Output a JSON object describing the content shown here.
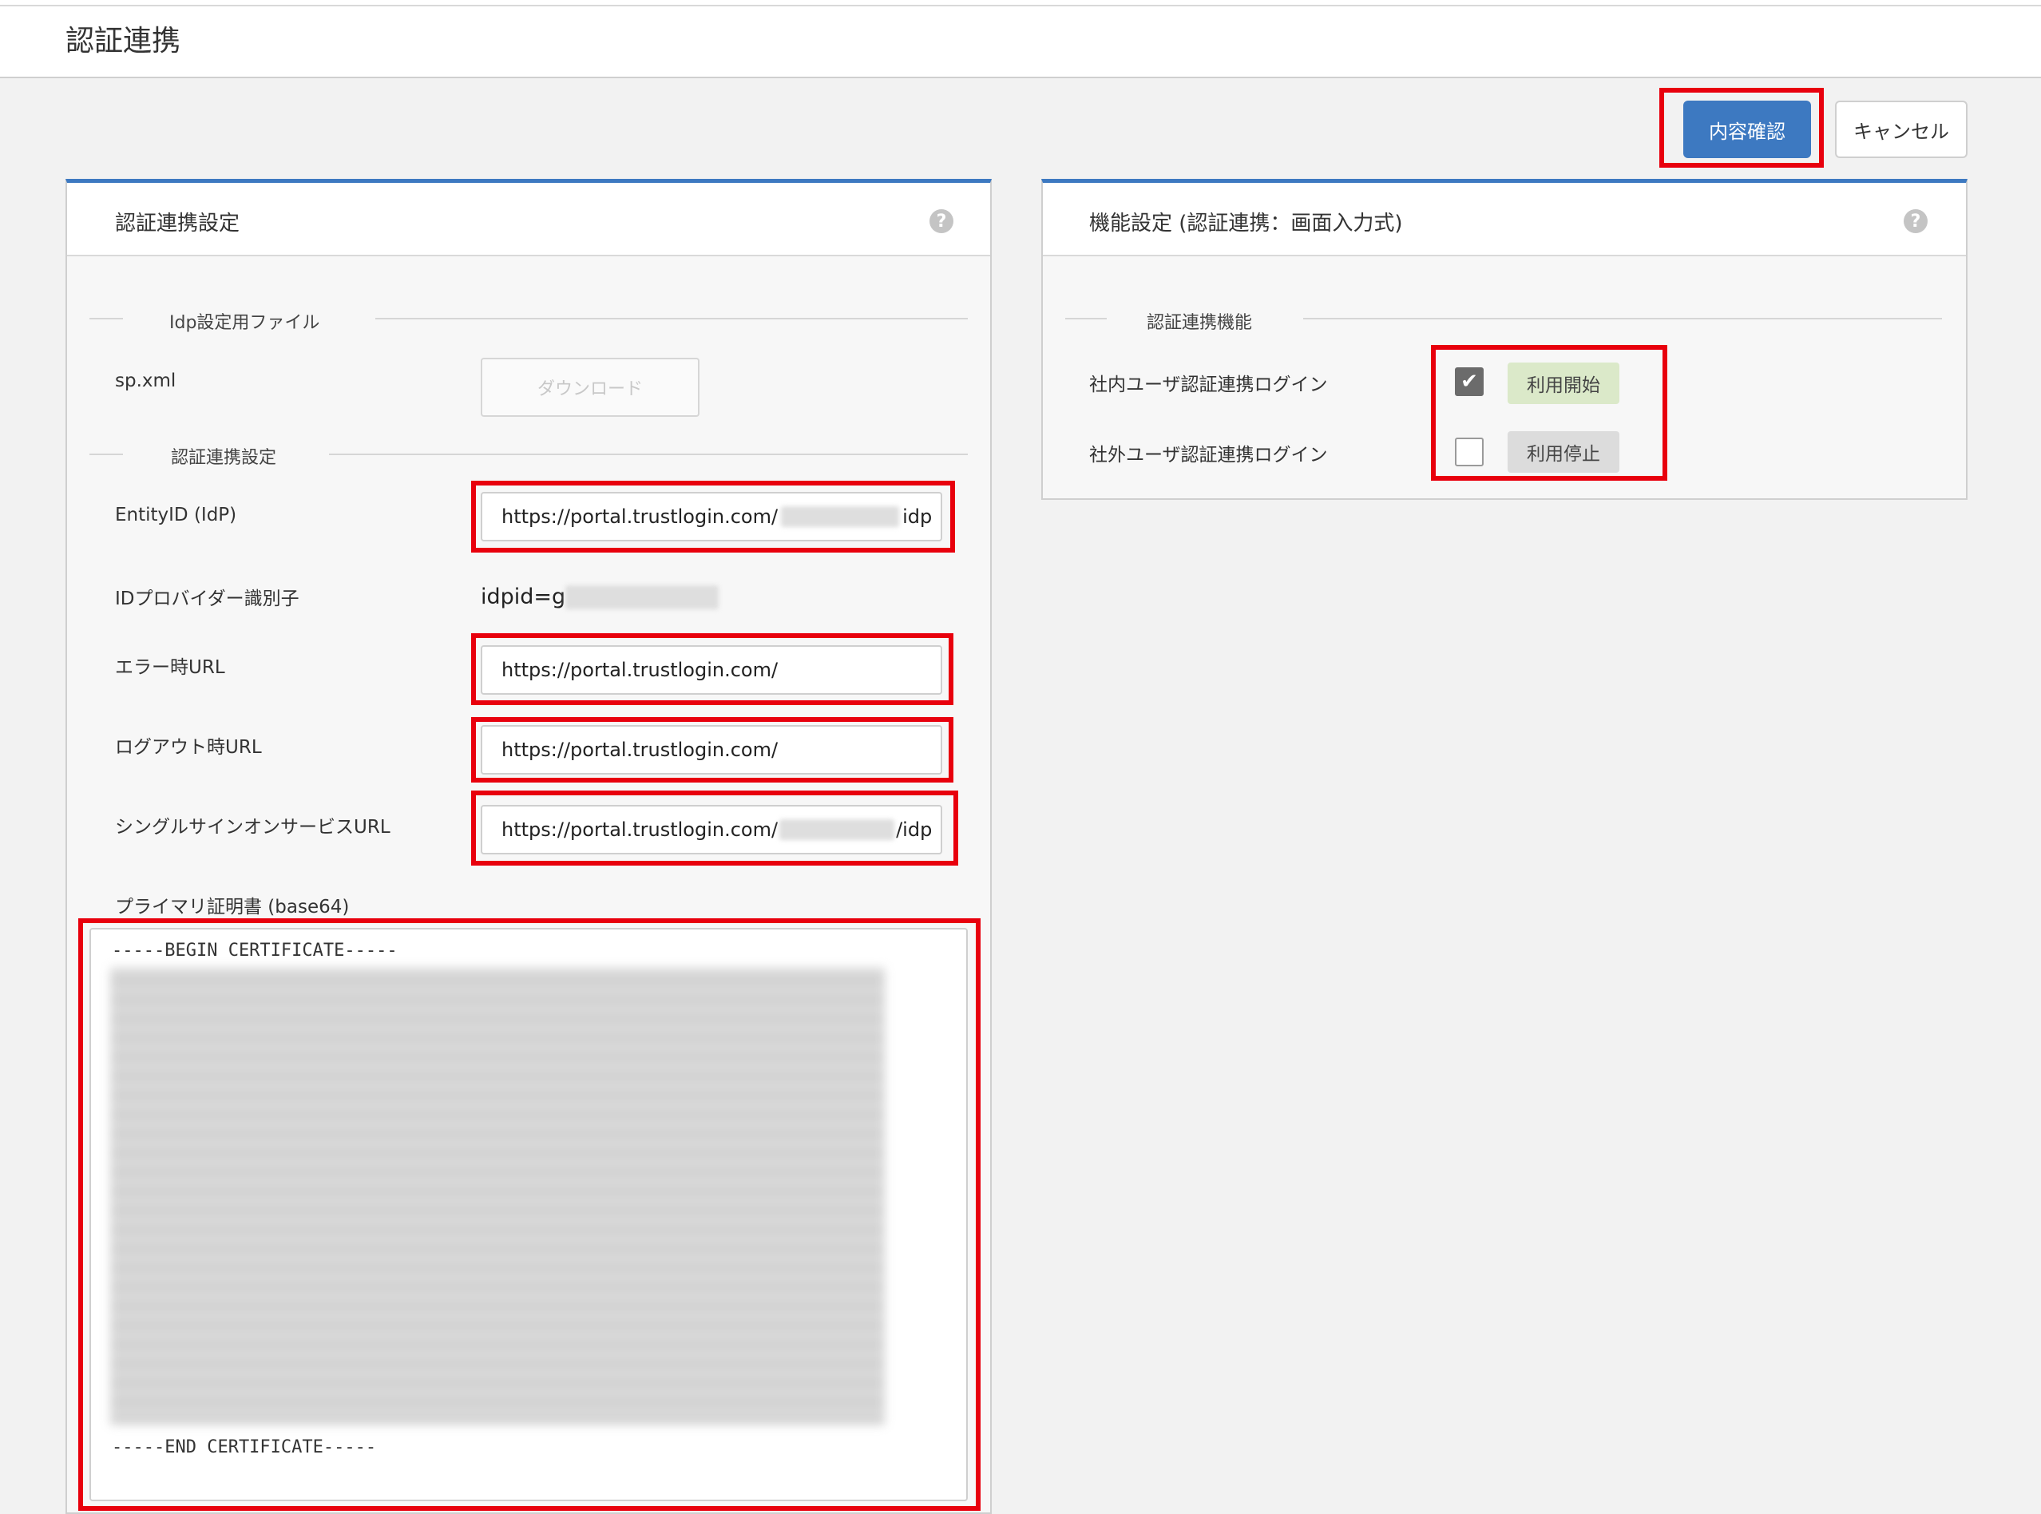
{
  "page": {
    "title": "認証連携"
  },
  "toolbar": {
    "confirm_label": "内容確認",
    "cancel_label": "キャンセル"
  },
  "left_panel": {
    "title": "認証連携設定",
    "help_icon": "question-circle-icon",
    "idp_file_section": "Idp設定用ファイル",
    "sp_xml_label": "sp.xml",
    "download_label": "ダウンロード",
    "settings_section": "認証連携設定",
    "fields": {
      "entity_id": {
        "label": "EntityID (IdP)",
        "value_prefix": "https://portal.trustlogin.com/",
        "value_suffix": "idp"
      },
      "idp_identifier": {
        "label": "IDプロバイダー識別子",
        "value_prefix": "idpid=g"
      },
      "error_url": {
        "label": "エラー時URL",
        "value": "https://portal.trustlogin.com/"
      },
      "logout_url": {
        "label": "ログアウト時URL",
        "value": "https://portal.trustlogin.com/"
      },
      "sso_url": {
        "label": "シングルサインオンサービスURL",
        "value_prefix": "https://portal.trustlogin.com/",
        "value_suffix": "/idp"
      }
    },
    "certificate": {
      "label": "プライマリ証明書 (base64)",
      "begin": "-----BEGIN CERTIFICATE-----",
      "end": "-----END CERTIFICATE-----"
    }
  },
  "right_panel": {
    "title": "機能設定 (認証連携：画面入力式)",
    "help_icon": "question-circle-icon",
    "section": "認証連携機能",
    "rows": [
      {
        "label": "社内ユーザ認証連携ログイン",
        "checked": true,
        "status": "利用開始"
      },
      {
        "label": "社外ユーザ認証連携ログイン",
        "checked": false,
        "status": "利用停止"
      }
    ]
  },
  "colors": {
    "primary": "#3d79c1",
    "highlight": "#e8000d",
    "status_on": "#dbe9c9",
    "status_off": "#dcdcdc"
  }
}
